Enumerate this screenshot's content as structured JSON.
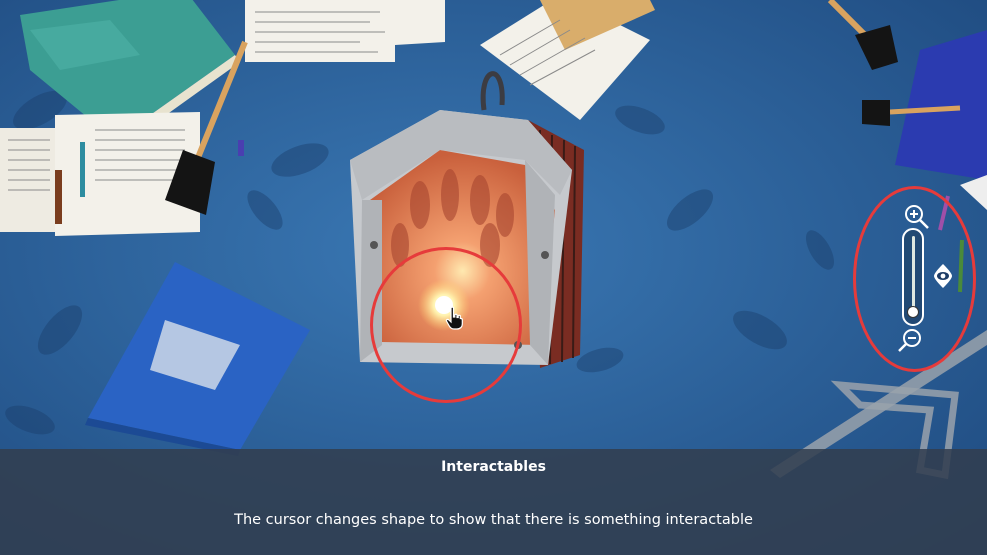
{
  "tutorial": {
    "title": "Interactables",
    "description": "The cursor changes shape to show that there is something interactable"
  },
  "zoom_control": {
    "level": 0.05,
    "zoom_in_icon": "zoom-in-magnifier-icon",
    "zoom_out_icon": "zoom-out-magnifier-icon",
    "camera_mode_icon": "eye-icon"
  },
  "colors": {
    "background_blue": "#2a5f97",
    "highlight_red": "#e63b3b",
    "overlay": "#323e4e",
    "lantern_glow": "#e8845a",
    "lantern_frame": "#c9c9c9"
  },
  "cursor": {
    "icon": "pointing-hand-cursor-icon"
  }
}
